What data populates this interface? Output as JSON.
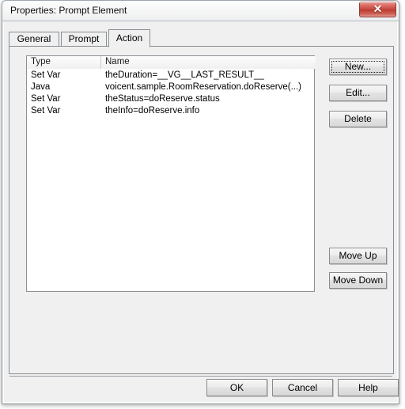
{
  "window": {
    "title": "Properties: Prompt Element",
    "close_icon": "close-icon",
    "close_glyph": "✕"
  },
  "tabs": [
    {
      "label": "General",
      "active": false
    },
    {
      "label": "Prompt",
      "active": false
    },
    {
      "label": "Action",
      "active": true
    }
  ],
  "list": {
    "columns": [
      "Type",
      "Name"
    ],
    "rows": [
      {
        "type": "Set Var",
        "name": "theDuration=__VG__LAST_RESULT__"
      },
      {
        "type": "Java",
        "name": "voicent.sample.RoomReservation.doReserve(...)"
      },
      {
        "type": "Set Var",
        "name": "theStatus=doReserve.status"
      },
      {
        "type": "Set Var",
        "name": "theInfo=doReserve.info"
      }
    ]
  },
  "side_buttons": {
    "new": "New...",
    "edit": "Edit...",
    "delete": "Delete",
    "move_up": "Move Up",
    "move_down": "Move Down"
  },
  "bottom_buttons": {
    "ok": "OK",
    "cancel": "Cancel",
    "help": "Help"
  },
  "colors": {
    "dialog_face": "#f0f0f0",
    "close_red": "#c74a40",
    "list_background": "#ffffff",
    "border": "#888e94"
  }
}
